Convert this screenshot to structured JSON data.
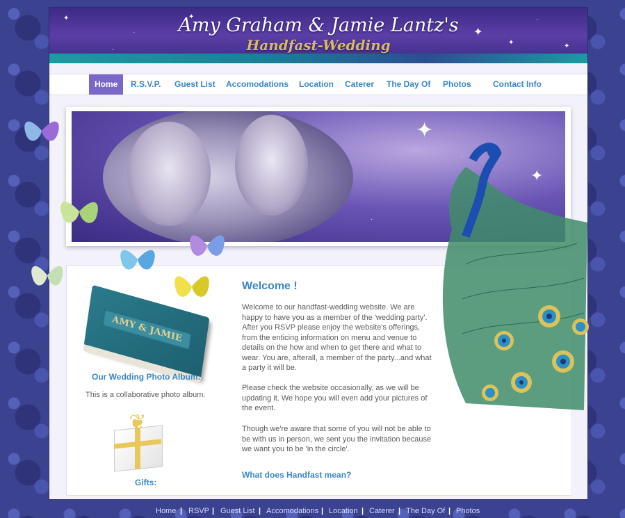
{
  "banner": {
    "title_line1": "Amy Graham & Jamie Lantz's",
    "title_line2": "Handfast-Wedding"
  },
  "nav": {
    "items": [
      "Home",
      "R.S.V.P.",
      "Guest List",
      "Accomodations",
      "Location",
      "Caterer",
      "The Day Of",
      "Photos",
      "Contact Info"
    ],
    "active": "Home"
  },
  "album": {
    "cover_text": "AMY & JAMIE",
    "heading": "Our Wedding Photo Album:",
    "description": "This is a collaborative photo album."
  },
  "gifts": {
    "heading": "Gifts:"
  },
  "welcome": {
    "heading": "Welcome !",
    "paragraphs": [
      "Welcome to our handfast-wedding website. We are happy to have you as a member of the 'wedding party'. After you RSVP please enjoy the website's offerings, from the enticing information on menu and venue to details on the how and when to get there and what to wear. You are, afterall, a member of the party...and what a party it will be.",
      "Please check the website occasionally, as we will be updating it. We hope you will even add your pictures of the event.",
      "Though we're aware that some of you will not be able to be with us in person, we sent you the invitation because we want you to be 'in the circle'."
    ],
    "subheading": "What does Handfast mean?"
  },
  "footer": {
    "items": [
      "Home",
      "RSVP",
      "Guest List",
      "Accomodations",
      "Location",
      "Caterer",
      "The Day Of",
      "Photos"
    ],
    "separator": "|"
  },
  "colors": {
    "accent": "#3a86c6",
    "nav_active_bg": "#7b67c8",
    "background": "#3b428f"
  }
}
